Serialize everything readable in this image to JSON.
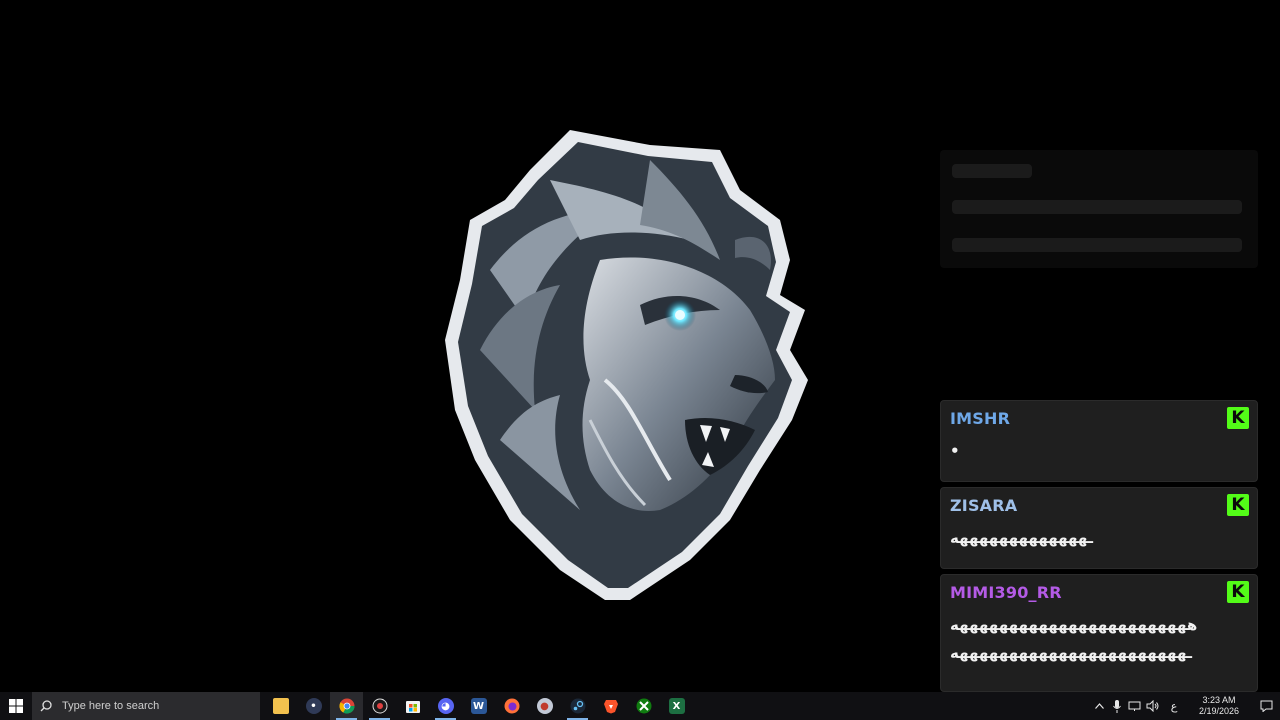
{
  "wallpaper": {
    "subject": "lion-head-logo",
    "background": "#000000"
  },
  "chat": {
    "platform_icon": "kick-logo-icon",
    "badge_letter": "K",
    "badge_color": "#53fc18",
    "messages": [
      {
        "username": "IMSHR",
        "color": "#6fa8e8",
        "lines": [
          "•"
        ]
      },
      {
        "username": "ZISARA",
        "color": "#9fc0e8",
        "lines": [
          "ـهههههههههههههه"
        ]
      },
      {
        "username": "MIMI390_RR",
        "color": "#b45be6",
        "lines": [
          "ههههههههههههههههههههههههه",
          "ـهههههههههههههههههههههههه"
        ]
      }
    ]
  },
  "taskbar": {
    "search_placeholder": "Type here to search",
    "apps": [
      {
        "name": "file-explorer",
        "icon": "folder-icon",
        "color": "#f2c14e"
      },
      {
        "name": "app-dark",
        "icon": "app-icon",
        "color": "#2f3a57"
      },
      {
        "name": "chrome",
        "icon": "chrome-icon",
        "color": "#4285f4"
      },
      {
        "name": "obs",
        "icon": "record-icon",
        "color": "#3a3a3a"
      },
      {
        "name": "microsoft-store",
        "icon": "store-icon",
        "color": "#2a7ed3"
      },
      {
        "name": "discord",
        "icon": "discord-icon",
        "color": "#5865f2"
      },
      {
        "name": "word",
        "icon": "word-icon",
        "color": "#2b5797"
      },
      {
        "name": "firefox",
        "icon": "firefox-icon",
        "color": "#ff7139"
      },
      {
        "name": "app-photo",
        "icon": "photo-icon",
        "color": "#c2c9d6"
      },
      {
        "name": "steam",
        "icon": "steam-icon",
        "color": "#1b2838"
      },
      {
        "name": "brave",
        "icon": "brave-icon",
        "color": "#fb542b"
      },
      {
        "name": "xbox",
        "icon": "xbox-icon",
        "color": "#107c10"
      },
      {
        "name": "excel",
        "icon": "excel-icon",
        "color": "#1d6f42"
      }
    ],
    "tray": {
      "language": "ع",
      "time": "3:23 AM",
      "date": "2/19/2026"
    }
  }
}
